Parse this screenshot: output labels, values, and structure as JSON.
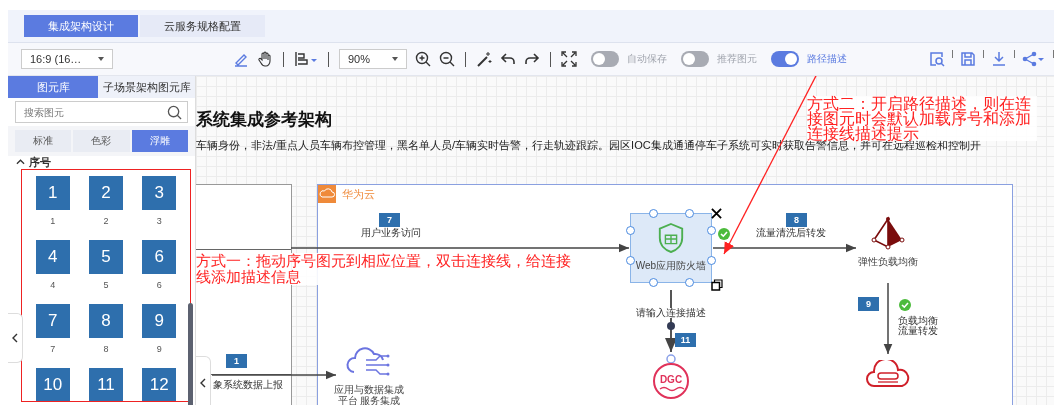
{
  "top_tabs": [
    {
      "label": "集成架构设计",
      "selected": true
    },
    {
      "label": "云服务规格配置",
      "selected": false
    }
  ],
  "toolbar": {
    "page_size": "16:9 (16…",
    "zoom": "90%",
    "toggles": [
      {
        "label": "自动保存",
        "on": false
      },
      {
        "label": "推荐图元",
        "on": false
      },
      {
        "label": "路径描述",
        "on": true
      }
    ]
  },
  "library": {
    "tabs": [
      {
        "label": "图元库",
        "selected": true
      },
      {
        "label": "子场景架构图元库",
        "selected": false
      }
    ],
    "search": {
      "placeholder": "搜索图元"
    },
    "styles": [
      {
        "label": "标准",
        "selected": false
      },
      {
        "label": "色彩",
        "selected": false
      },
      {
        "label": "浮雕",
        "selected": true
      }
    ],
    "section": {
      "title": "序号",
      "expanded": true
    },
    "tiles": [
      {
        "number": "1",
        "label": "1"
      },
      {
        "number": "2",
        "label": "2"
      },
      {
        "number": "3",
        "label": "3"
      },
      {
        "number": "4",
        "label": "4"
      },
      {
        "number": "5",
        "label": "5"
      },
      {
        "number": "6",
        "label": "6"
      },
      {
        "number": "7",
        "label": "7"
      },
      {
        "number": "8",
        "label": "8"
      },
      {
        "number": "9",
        "label": "9"
      },
      {
        "number": "10"
      },
      {
        "number": "11"
      },
      {
        "number": "12"
      }
    ]
  },
  "canvas": {
    "title": "系统集成参考架构",
    "description": "车辆身份，非法/重点人员车辆布控管理，黑名单人员/车辆实时告警，行走轨迹跟踪。园区IOC集成通通停车子系统可实时获取告警信息，并可在远程巡检和控制开",
    "group_label": "华为云",
    "nodes": [
      {
        "kind": "firewall",
        "lines": [
          "Web应用防火墙"
        ],
        "selected": true
      },
      {
        "kind": "load-balancer",
        "lines": [
          "弹性负载均衡"
        ],
        "selected": false
      },
      {
        "kind": "api",
        "lines": [
          "应用与数据集成",
          "平台 服务集成"
        ],
        "selected": false
      },
      {
        "kind": "dgc",
        "icon_text": "DGC",
        "selected": false
      },
      {
        "kind": "ioc",
        "selected": false
      }
    ],
    "edges": [
      {
        "badge": "7",
        "lines": [
          "用户业务访问"
        ]
      },
      {
        "badge": "8",
        "lines": [
          "流量清洗后转发"
        ],
        "checked": true
      },
      {
        "badge": "11",
        "lines": [
          "请输入连接描述"
        ]
      },
      {
        "badge": "9",
        "lines": [
          "负载均衡",
          "流量转发"
        ],
        "checked": true
      },
      {
        "badge": "1",
        "lines": [
          "象系统数据上报"
        ]
      }
    ],
    "annotations": [
      "方式一：拖动序号图元到相应位置，双击连接线，给连接线添加描述信息",
      "方式二：开启路径描述，则在连接图元时会默认加载序号和添加连接线描述提示"
    ]
  }
}
